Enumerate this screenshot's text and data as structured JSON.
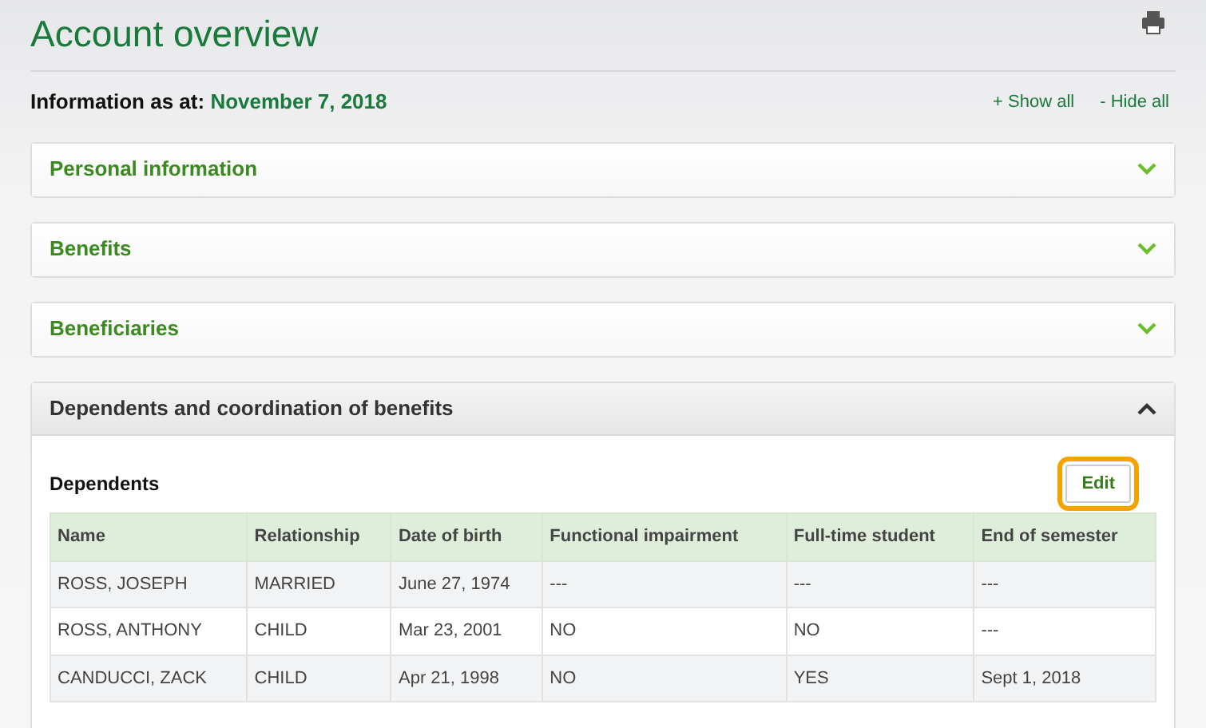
{
  "page": {
    "title": "Account overview"
  },
  "info": {
    "label": "Information as at:",
    "date": "November 7, 2018"
  },
  "links": [
    "+ Show all",
    "- Hide all"
  ],
  "panels": [
    {
      "title": "Personal information",
      "expanded": false
    },
    {
      "title": "Benefits",
      "expanded": false
    },
    {
      "title": "Beneficiaries",
      "expanded": false
    },
    {
      "title": "Dependents and coordination of benefits",
      "expanded": true,
      "section": "Dependents",
      "edit_button": {
        "label": "Edit",
        "highlighted": true
      },
      "table": {
        "columns": [
          "Name",
          "Relationship",
          "Date of birth",
          "Functional impairment",
          "Full-time student",
          "End of semester"
        ],
        "rows": [
          [
            "ROSS, JOSEPH",
            "MARRIED",
            "June 27, 1974",
            "---",
            "---",
            "---"
          ],
          [
            "ROSS, ANTHONY",
            "CHILD",
            "Mar 23, 2001",
            "NO",
            "NO",
            "---"
          ],
          [
            "CANDUCCI, ZACK",
            "CHILD",
            "Apr 21, 1998",
            "NO",
            "YES",
            "Sept 1, 2018"
          ]
        ]
      }
    }
  ]
}
